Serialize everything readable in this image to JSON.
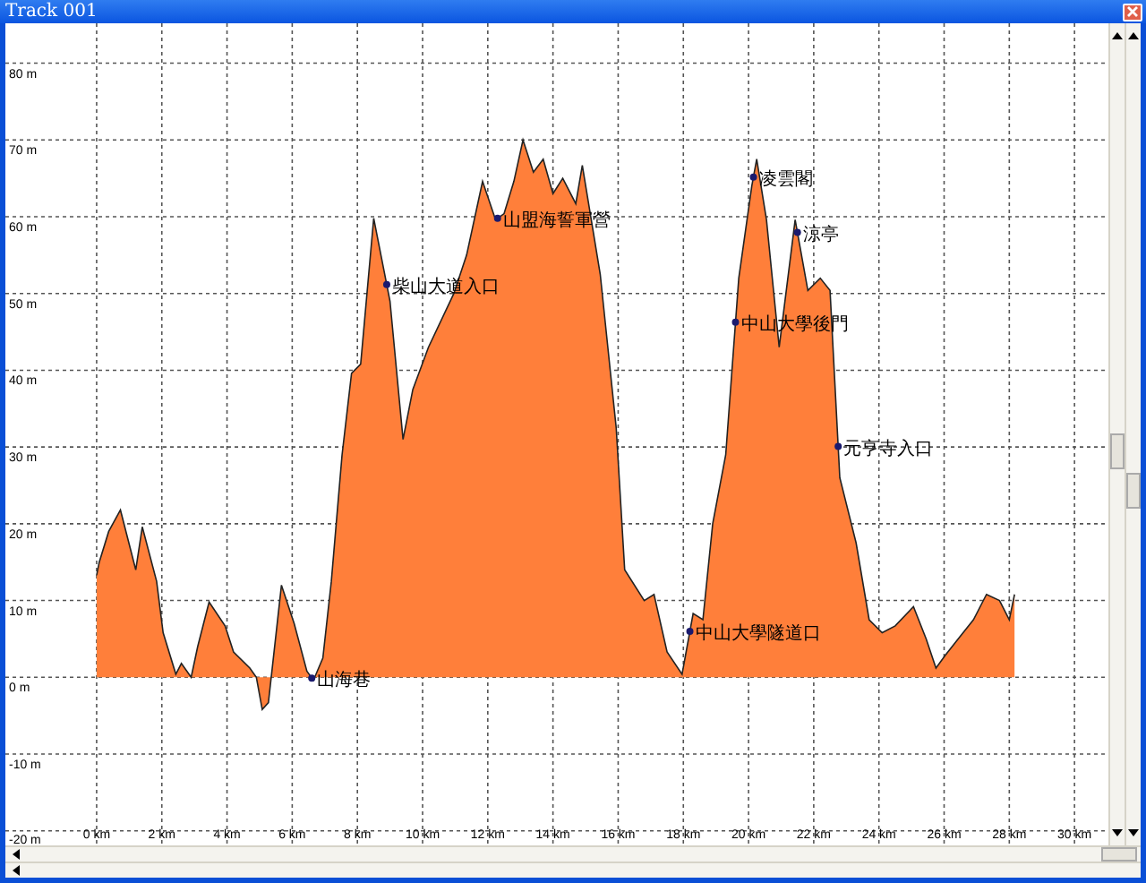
{
  "window": {
    "title": "Track 001"
  },
  "chart_data": {
    "type": "area",
    "grid": true,
    "xlim": [
      -2.8,
      31.04
    ],
    "ylim": [
      -21.9,
      85.2
    ],
    "x": [
      0,
      0.08,
      0.37,
      0.73,
      1.2,
      1.4,
      1.84,
      2.04,
      2.43,
      2.6,
      2.9,
      3.1,
      3.45,
      3.94,
      4.2,
      4.7,
      4.9,
      5.08,
      5.27,
      5.67,
      6.06,
      6.45,
      6.65,
      6.94,
      7.2,
      7.53,
      7.82,
      8.1,
      8.5,
      9.0,
      9.4,
      9.7,
      10.18,
      10.96,
      11.35,
      11.84,
      12.24,
      12.5,
      12.8,
      13.08,
      13.4,
      13.7,
      14.0,
      14.3,
      14.7,
      14.9,
      15.45,
      15.94,
      16.2,
      16.8,
      17.1,
      17.5,
      17.96,
      18.3,
      18.6,
      18.9,
      19.3,
      19.7,
      20.1,
      20.25,
      20.55,
      20.94,
      21.43,
      21.82,
      22.2,
      22.5,
      22.8,
      23.3,
      23.7,
      24.1,
      24.5,
      25.06,
      25.45,
      25.75,
      26.04,
      26.43,
      26.9,
      27.3,
      27.7,
      28.0,
      28.16
    ],
    "values": [
      13.3,
      15,
      19,
      21.8,
      14,
      19.6,
      12.5,
      5.8,
      0.4,
      1.8,
      0,
      4,
      9.8,
      6.7,
      3.3,
      1.2,
      0,
      -4.2,
      -3.3,
      12,
      7,
      0.8,
      -0.4,
      2.5,
      12.5,
      29,
      39.6,
      40.8,
      59.8,
      49,
      31,
      37.5,
      43,
      50,
      55,
      64.6,
      59.6,
      60.4,
      64.6,
      70,
      65.8,
      67.5,
      63,
      65,
      61.7,
      66.7,
      52.5,
      32.5,
      14,
      10,
      10.8,
      3.3,
      0.4,
      8.3,
      7.5,
      20,
      29,
      52,
      64,
      67.5,
      59.6,
      43,
      59.6,
      50.4,
      52,
      50.4,
      26,
      17.5,
      7.5,
      5.8,
      6.7,
      9.2,
      5,
      1.2,
      2.9,
      5,
      7.5,
      10.8,
      10,
      7.5,
      10.8
    ],
    "xticks": [
      {
        "value": 0,
        "label": "0 km"
      },
      {
        "value": 2,
        "label": "2 km"
      },
      {
        "value": 4,
        "label": "4 km"
      },
      {
        "value": 6,
        "label": "6 km"
      },
      {
        "value": 8,
        "label": "8 km"
      },
      {
        "value": 10,
        "label": "10 km"
      },
      {
        "value": 12,
        "label": "12 km"
      },
      {
        "value": 14,
        "label": "14 km"
      },
      {
        "value": 16,
        "label": "16 km"
      },
      {
        "value": 18,
        "label": "18 km"
      },
      {
        "value": 20,
        "label": "20 km"
      },
      {
        "value": 22,
        "label": "22 km"
      },
      {
        "value": 24,
        "label": "24 km"
      },
      {
        "value": 26,
        "label": "26 km"
      },
      {
        "value": 28,
        "label": "28 km"
      },
      {
        "value": 30,
        "label": "30 km"
      }
    ],
    "yticks": [
      {
        "value": 80,
        "label": "80 m"
      },
      {
        "value": 70,
        "label": "70 m"
      },
      {
        "value": 60,
        "label": "60 m"
      },
      {
        "value": 50,
        "label": "50 m"
      },
      {
        "value": 40,
        "label": "40 m"
      },
      {
        "value": 30,
        "label": "30 m"
      },
      {
        "value": 20,
        "label": "20 m"
      },
      {
        "value": 10,
        "label": "10 m"
      },
      {
        "value": 0,
        "label": "0 m"
      },
      {
        "value": -10,
        "label": "-10 m"
      },
      {
        "value": -20,
        "label": "-20 m"
      }
    ],
    "annotations": [
      {
        "x": 6.6,
        "text": "山海巷"
      },
      {
        "x": 8.9,
        "text": "柴山大道入口"
      },
      {
        "x": 12.3,
        "text": "山盟海誓軍營"
      },
      {
        "x": 20.15,
        "text": "凌雲閣"
      },
      {
        "x": 21.5,
        "text": "涼亭"
      },
      {
        "x": 19.6,
        "text": "中山大學後門"
      },
      {
        "x": 22.75,
        "text": "元亨寺入口"
      },
      {
        "x": 18.2,
        "text": "中山大學隧道口"
      }
    ]
  }
}
